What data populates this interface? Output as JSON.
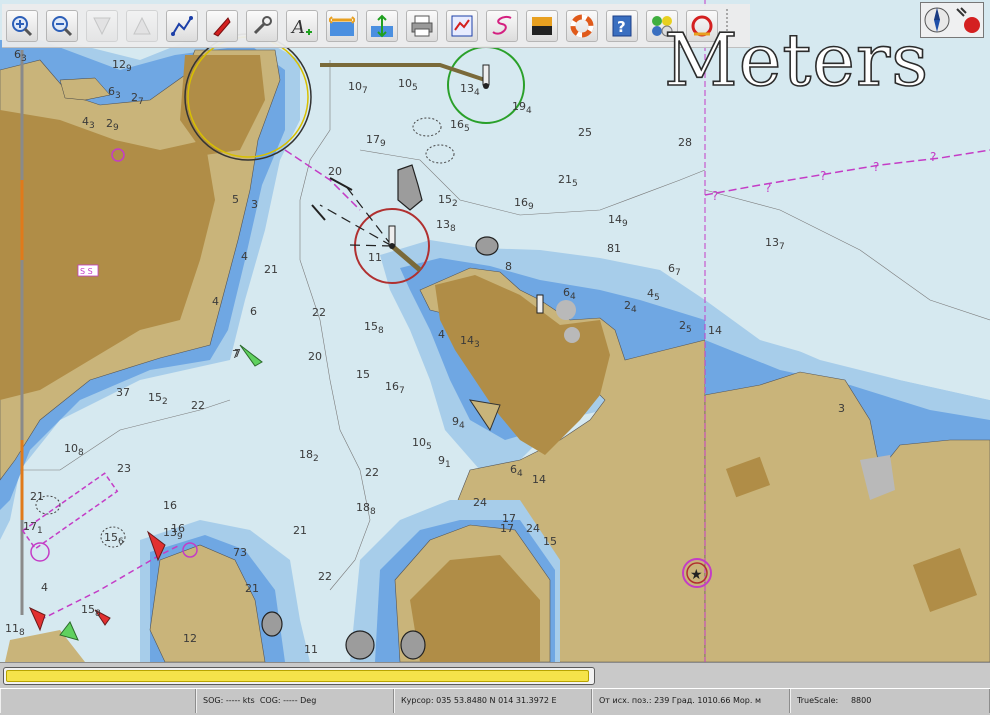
{
  "toolbar": {
    "buttons": [
      {
        "name": "zoom-in",
        "enabled": true
      },
      {
        "name": "zoom-out",
        "enabled": true
      },
      {
        "name": "scale-in",
        "enabled": false
      },
      {
        "name": "scale-out",
        "enabled": false
      },
      {
        "name": "route",
        "enabled": true
      },
      {
        "name": "ais",
        "enabled": true
      },
      {
        "name": "settings",
        "enabled": true
      },
      {
        "name": "text",
        "enabled": true
      },
      {
        "name": "current",
        "enabled": true
      },
      {
        "name": "tide",
        "enabled": true
      },
      {
        "name": "print",
        "enabled": true
      },
      {
        "name": "route-manager",
        "enabled": true
      },
      {
        "name": "track",
        "enabled": true
      },
      {
        "name": "color-scheme",
        "enabled": true
      },
      {
        "name": "mob",
        "enabled": true
      },
      {
        "name": "help",
        "enabled": true
      },
      {
        "name": "dashboard",
        "enabled": true
      },
      {
        "name": "pilot",
        "enabled": true
      }
    ]
  },
  "units_label": "Meters",
  "soundings": [
    {
      "v": "12",
      "s": "9"
    },
    {
      "v": "2",
      "s": "7"
    },
    {
      "v": "4",
      "s": "3"
    },
    {
      "v": "2",
      "s": "9"
    },
    {
      "v": "10",
      "s": "7"
    },
    {
      "v": "10",
      "s": "5"
    },
    {
      "v": "13",
      "s": "4"
    },
    {
      "v": "19",
      "s": "4"
    },
    {
      "v": "6",
      "s": "3"
    },
    {
      "v": "25",
      "s": ""
    },
    {
      "v": "17",
      "s": "9"
    },
    {
      "v": "16",
      "s": "5"
    },
    {
      "v": "28",
      "s": ""
    },
    {
      "v": "20",
      "s": ""
    },
    {
      "v": "15",
      "s": "2"
    },
    {
      "v": "21",
      "s": "5"
    },
    {
      "v": "16",
      "s": "9"
    },
    {
      "v": "13",
      "s": "8"
    },
    {
      "v": "14",
      "s": "9"
    },
    {
      "v": "13",
      "s": "7"
    },
    {
      "v": "11",
      "s": ""
    },
    {
      "v": "8",
      "s": ""
    },
    {
      "v": "81",
      "s": ""
    },
    {
      "v": "6",
      "s": "7"
    },
    {
      "v": "6",
      "s": "4"
    },
    {
      "v": "4",
      "s": "5"
    },
    {
      "v": "2",
      "s": "4"
    },
    {
      "v": "2",
      "s": "5"
    },
    {
      "v": "14",
      "s": ""
    },
    {
      "v": "21",
      "s": ""
    },
    {
      "v": "22",
      "s": ""
    },
    {
      "v": "15",
      "s": "8"
    },
    {
      "v": "20",
      "s": ""
    },
    {
      "v": "15",
      "s": ""
    },
    {
      "v": "16",
      "s": "7"
    },
    {
      "v": "15",
      "s": "2"
    },
    {
      "v": "22",
      "s": ""
    },
    {
      "v": "37",
      "s": ""
    },
    {
      "v": "23",
      "s": ""
    },
    {
      "v": "10",
      "s": "8"
    },
    {
      "v": "14",
      "s": "3"
    },
    {
      "v": "18",
      "s": "2"
    },
    {
      "v": "22",
      "s": ""
    },
    {
      "v": "18",
      "s": "8"
    },
    {
      "v": "21",
      "s": ""
    },
    {
      "v": "16",
      "s": ""
    },
    {
      "v": "17",
      "s": "1"
    },
    {
      "v": "15",
      "s": "6"
    },
    {
      "v": "10",
      "s": "5"
    },
    {
      "v": "9",
      "s": "1"
    },
    {
      "v": "9",
      "s": "4"
    },
    {
      "v": "6",
      "s": "4"
    },
    {
      "v": "14",
      "s": ""
    },
    {
      "v": "24",
      "s": ""
    },
    {
      "v": "17",
      "s": ""
    },
    {
      "v": "24",
      "s": ""
    },
    {
      "v": "15",
      "s": ""
    },
    {
      "v": "4",
      "s": ""
    },
    {
      "v": "4",
      "s": ""
    },
    {
      "v": "7",
      "s": ""
    },
    {
      "v": "73",
      "s": ""
    },
    {
      "v": "21",
      "s": ""
    },
    {
      "v": "12",
      "s": ""
    },
    {
      "v": "11",
      "s": ""
    },
    {
      "v": "15",
      "s": "8"
    },
    {
      "v": "11",
      "s": "8"
    },
    {
      "v": "7",
      "s": ""
    },
    {
      "v": "6",
      "s": ""
    },
    {
      "v": "22",
      "s": ""
    },
    {
      "v": "4",
      "s": ""
    },
    {
      "v": "3",
      "s": ""
    },
    {
      "v": "5",
      "s": ""
    },
    {
      "v": "3",
      "s": ""
    },
    {
      "v": "6",
      "s": "3"
    },
    {
      "v": "16",
      "s": ""
    },
    {
      "v": "4",
      "s": ""
    },
    {
      "v": "21",
      "s": ""
    },
    {
      "v": "13",
      "s": "9"
    },
    {
      "v": "17",
      "s": ""
    }
  ],
  "chart_labels": {
    "ss_label": "S S",
    "question_mark": "?"
  },
  "progress": {
    "value": 0.995
  },
  "status": {
    "sog": "SOG: ----- kts",
    "cog": "COG: ----- Deg",
    "cursor": "Курсор: 035 53.8480 N 014 31.3972 E",
    "from_pos": "От исх. поз.: 239 Град.  1010.66 Мор. м",
    "true_scale": "TrueScale:",
    "scale_value": "8800"
  },
  "colors": {
    "deep_water": "#d6e9f0",
    "shallow_water": "#a7cdea",
    "very_shallow": "#6fa7e3",
    "land": "#c9b47a",
    "dark_land": "#b08d47",
    "restriction_line": "#c43cc6"
  }
}
